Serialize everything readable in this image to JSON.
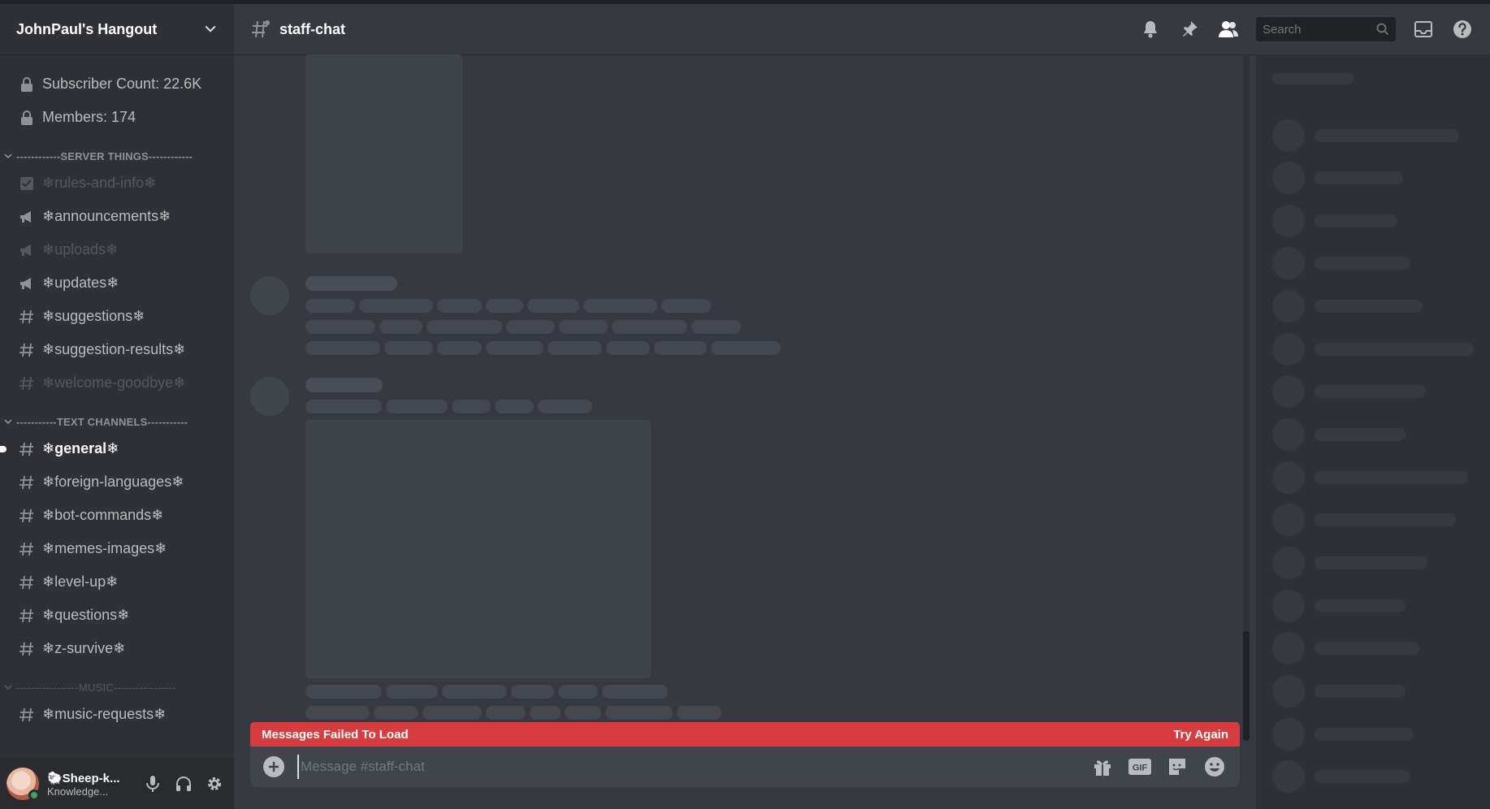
{
  "server": {
    "name": "JohnPaul's Hangout"
  },
  "channel": {
    "name": "staff-chat"
  },
  "search": {
    "placeholder": "Search"
  },
  "sidebar": {
    "top_channels": [
      {
        "label": "Subscriber Count: 22.6K",
        "icon": "lock-icon"
      },
      {
        "label": "Members: 174",
        "icon": "lock-icon"
      }
    ],
    "categories": [
      {
        "label": "------------SERVER THINGS------------",
        "channels": [
          {
            "label": "❄rules-and-info❄",
            "icon": "checkbox-icon",
            "state": "muted"
          },
          {
            "label": "❄announcements❄",
            "icon": "megaphone-icon",
            "state": "light"
          },
          {
            "label": "❄uploads❄",
            "icon": "megaphone-icon",
            "state": "muted"
          },
          {
            "label": "❄updates❄",
            "icon": "megaphone-icon",
            "state": "light"
          },
          {
            "label": "❄suggestions❄",
            "icon": "hash-icon",
            "state": "light"
          },
          {
            "label": "❄suggestion-results❄",
            "icon": "hash-icon",
            "state": "light"
          },
          {
            "label": "❄welcome-goodbye❄",
            "icon": "hash-icon",
            "state": "muted"
          }
        ]
      },
      {
        "label": "-----------TEXT CHANNELS-----------",
        "channels": [
          {
            "label": "❄general❄",
            "icon": "hash-icon",
            "state": "active"
          },
          {
            "label": "❄foreign-languages❄",
            "icon": "hash-icon",
            "state": "light"
          },
          {
            "label": "❄bot-commands❄",
            "icon": "hash-icon",
            "state": "light"
          },
          {
            "label": "❄memes-images❄",
            "icon": "hash-icon",
            "state": "light"
          },
          {
            "label": "❄level-up❄",
            "icon": "hash-icon",
            "state": "light"
          },
          {
            "label": "❄questions❄",
            "icon": "hash-icon",
            "state": "light"
          },
          {
            "label": "❄z-survive❄",
            "icon": "hash-icon",
            "state": "light"
          }
        ]
      },
      {
        "label": "-----------------MUSIC-----------------",
        "channels": [
          {
            "label": "❄music-requests❄",
            "icon": "hash-icon",
            "state": "light"
          }
        ]
      }
    ]
  },
  "user": {
    "name": "🐑Sheep-k...",
    "status": "Knowledge..."
  },
  "error": {
    "message": "Messages Failed To Load",
    "action": "Try Again"
  },
  "composer": {
    "placeholder": "Message #staff-chat"
  },
  "colors": {
    "error": "#d83c3e",
    "online": "#3ba55d",
    "sidebar": "#2f3136",
    "chat": "#36393f"
  }
}
